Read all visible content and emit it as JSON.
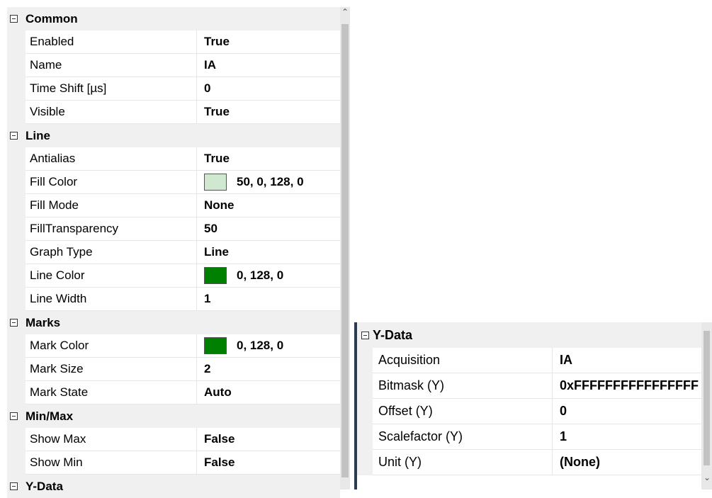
{
  "left_grid": {
    "categories": [
      {
        "label": "Common",
        "properties": [
          {
            "name": "Enabled",
            "value": "True"
          },
          {
            "name": "Name",
            "value": "IA"
          },
          {
            "name": "Time Shift [µs]",
            "value": "0"
          },
          {
            "name": "Visible",
            "value": "True"
          }
        ]
      },
      {
        "label": "Line",
        "properties": [
          {
            "name": "Antialias",
            "value": "True"
          },
          {
            "name": "Fill Color",
            "value": "50, 0, 128, 0",
            "swatch": "#cfe8cf"
          },
          {
            "name": "Fill Mode",
            "value": "None"
          },
          {
            "name": "FillTransparency",
            "value": "50"
          },
          {
            "name": "Graph Type",
            "value": "Line"
          },
          {
            "name": "Line Color",
            "value": "0, 128, 0",
            "swatch": "#008000"
          },
          {
            "name": "Line Width",
            "value": "1"
          }
        ]
      },
      {
        "label": "Marks",
        "properties": [
          {
            "name": "Mark Color",
            "value": "0, 128, 0",
            "swatch": "#008000"
          },
          {
            "name": "Mark Size",
            "value": "2"
          },
          {
            "name": "Mark State",
            "value": "Auto"
          }
        ]
      },
      {
        "label": "Min/Max",
        "properties": [
          {
            "name": "Show Max",
            "value": "False"
          },
          {
            "name": "Show Min",
            "value": "False"
          }
        ]
      },
      {
        "label": "Y-Data",
        "properties": []
      }
    ]
  },
  "right_grid": {
    "categories": [
      {
        "label": "Y-Data",
        "properties": [
          {
            "name": "Acquisition",
            "value": "IA"
          },
          {
            "name": "Bitmask (Y)",
            "value": "0xFFFFFFFFFFFFFFFF"
          },
          {
            "name": "Offset (Y)",
            "value": "0"
          },
          {
            "name": "Scalefactor (Y)",
            "value": "1"
          },
          {
            "name": "Unit (Y)",
            "value": "(None)"
          }
        ]
      }
    ]
  },
  "icons": {
    "collapse": "minus-box-icon",
    "scroll_up": "chevron-up-icon",
    "scroll_down": "chevron-down-icon"
  }
}
